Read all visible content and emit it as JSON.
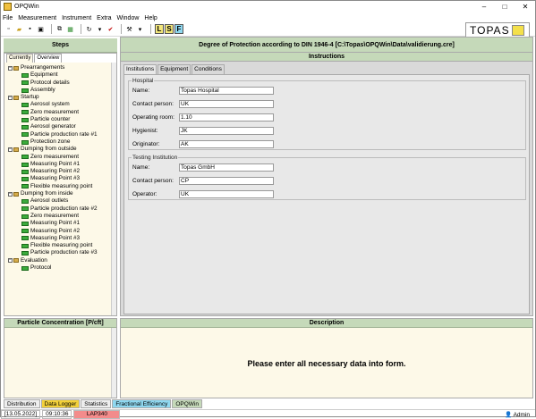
{
  "titlebar": {
    "title": "OPQWin",
    "minimize": "–",
    "maximize": "□",
    "close": "✕"
  },
  "menu": [
    "File",
    "Measurement",
    "Instrument",
    "Extra",
    "Window",
    "Help"
  ],
  "toolbar": {
    "lsf": [
      "L",
      "S",
      "F"
    ],
    "lsf_colors": {
      "L": "#f3e77b",
      "S": "#f3e77b",
      "F": "#8fd8f0"
    }
  },
  "logo": {
    "text": "TOPAS"
  },
  "header": {
    "title": "Degree of Protection according to DIN 1946-4 [C:\\Topas\\OPQWin\\Data\\validierung.cre]"
  },
  "steps": {
    "title": "Steps",
    "tabs": [
      "Currently",
      "Overview"
    ],
    "tree": [
      {
        "type": "group",
        "label": "Prearrangements"
      },
      {
        "type": "leaf",
        "label": "Equipment"
      },
      {
        "type": "leaf",
        "label": "Protocol details"
      },
      {
        "type": "leaf",
        "label": "Assembly"
      },
      {
        "type": "group",
        "label": "Startup"
      },
      {
        "type": "leaf",
        "label": "Aerosol system"
      },
      {
        "type": "leaf",
        "label": "Zero measurement"
      },
      {
        "type": "leaf",
        "label": "Particle counter"
      },
      {
        "type": "leaf",
        "label": "Aerosol generator"
      },
      {
        "type": "leaf",
        "label": "Particle production rate #1"
      },
      {
        "type": "leaf",
        "label": "Protection zone"
      },
      {
        "type": "group",
        "label": "Dumping from outside"
      },
      {
        "type": "leaf",
        "label": "Zero measurement"
      },
      {
        "type": "leaf",
        "label": "Measuring Point #1"
      },
      {
        "type": "leaf",
        "label": "Measuring Point #2"
      },
      {
        "type": "leaf",
        "label": "Measuring Point #3"
      },
      {
        "type": "leaf",
        "label": "Flexible measuring point"
      },
      {
        "type": "group",
        "label": "Dumping from inside"
      },
      {
        "type": "leaf",
        "label": "Aerosol outlets"
      },
      {
        "type": "leaf",
        "label": "Particle production rate #2"
      },
      {
        "type": "leaf",
        "label": "Zero measurement"
      },
      {
        "type": "leaf",
        "label": "Measuring Point #1"
      },
      {
        "type": "leaf",
        "label": "Measuring Point #2"
      },
      {
        "type": "leaf",
        "label": "Measuring Point #3"
      },
      {
        "type": "leaf",
        "label": "Flexible measuring point"
      },
      {
        "type": "leaf",
        "label": "Particle production rate #3"
      },
      {
        "type": "group",
        "label": "Evaluation"
      },
      {
        "type": "leaf",
        "label": "Protocol"
      }
    ]
  },
  "instructions": {
    "title": "Instructions",
    "tabs": [
      "Institutions",
      "Equipment",
      "Conditions"
    ],
    "hospital": {
      "title": "Hospital",
      "fields": [
        {
          "label": "Name:",
          "value": "Topas Hospital"
        },
        {
          "label": "Contact person:",
          "value": "UK"
        },
        {
          "label": "Operating room:",
          "value": "1.10"
        },
        {
          "label": "Hygienist:",
          "value": "JK"
        },
        {
          "label": "Originator:",
          "value": "AK"
        }
      ]
    },
    "testing": {
      "title": "Testing Institution",
      "fields": [
        {
          "label": "Name:",
          "value": "Topas GmbH"
        },
        {
          "label": "Contact person:",
          "value": "CP"
        },
        {
          "label": "Operator:",
          "value": "UK"
        }
      ]
    }
  },
  "particle": {
    "title": "Particle Concentration [P/cft]"
  },
  "description": {
    "title": "Description",
    "message": "Please enter all necessary data into form."
  },
  "bottom_tabs": [
    {
      "label": "Distribution",
      "color": "#eeeeee"
    },
    {
      "label": "Data Logger",
      "color": "#f3d13a"
    },
    {
      "label": "Statistics",
      "color": "#eeeeee"
    },
    {
      "label": "Fractional Efficiency",
      "color": "#8fd8f0"
    },
    {
      "label": "OPQWin",
      "color": "#c5d9b9"
    }
  ],
  "status": {
    "date": "[13.05.2022]",
    "time": "09:10:36",
    "device": "LAP340",
    "user": "Admin"
  }
}
